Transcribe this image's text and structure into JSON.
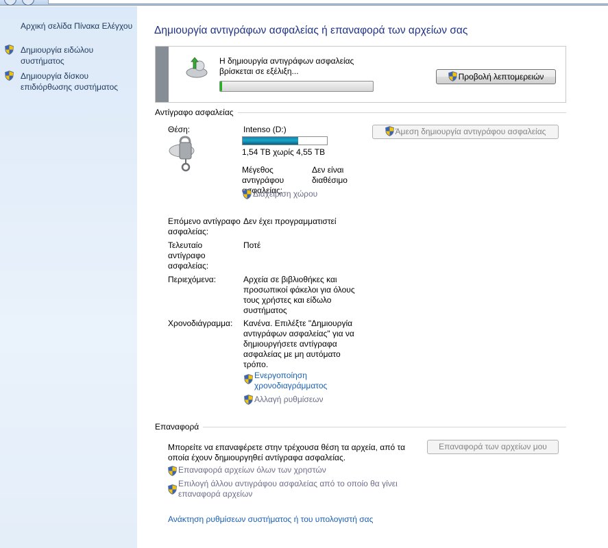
{
  "sidebar": {
    "home_link": "Αρχική σελίδα Πίνακα Ελέγχου",
    "links": [
      {
        "label": "Δημιουργία ειδώλου συστήματος"
      },
      {
        "label": "Δημιουργία δίσκου επιδιόρθωσης συστήματος"
      }
    ]
  },
  "main": {
    "title": "Δημιουργία αντιγράφων ασφαλείας ή επαναφορά των αρχείων σας",
    "status": {
      "message": "Η δημιουργία αντιγράφων ασφαλείας βρίσκεται σε εξέλιξη...",
      "progress_fraction": 0.01,
      "details_button": "Προβολή λεπτομερειών"
    },
    "backup": {
      "section_title": "Αντίγραφο ασφαλείας",
      "location_label": "Θέση:",
      "drive_name": "Intenso (D:)",
      "drive_used_fraction": 0.66,
      "drive_space": "1,54 TB χωρίς 4,55 TB",
      "size_label": "Μέγεθος αντιγράφου ασφαλείας:",
      "size_value": "Δεν είναι διαθέσιμο",
      "manage_space_link": "Διαχείριση χώρου",
      "backup_now_button": "Άμεση δημιουργία αντιγράφου ασφαλείας",
      "next_label": "Επόμενο αντίγραφο ασφαλείας:",
      "next_value": "Δεν έχει προγραμματιστεί",
      "last_label": "Τελευταίο αντίγραφο ασφαλείας:",
      "last_value": "Ποτέ",
      "contents_label": "Περιεχόμενα:",
      "contents_value": "Αρχεία σε βιβλιοθήκες και προσωπικοί φάκελοι για όλους τους χρήστες και είδωλο συστήματος",
      "schedule_label": "Χρονοδιάγραμμα:",
      "schedule_value": "Κανένα. Επιλέξτε \"Δημιουργία αντιγράφων ασφαλείας\" για να δημιουργήσετε αντίγραφα ασφαλείας με μη αυτόματο τρόπο.",
      "enable_schedule_link": "Ενεργοποίηση χρονοδιαγράμματος",
      "change_settings_link": "Αλλαγή ρυθμίσεων"
    },
    "restore": {
      "section_title": "Επαναφορά",
      "description": "Μπορείτε να επαναφέρετε στην τρέχουσα θέση τα αρχεία, από τα οποία έχουν δημιουργηθεί αντίγραφα ασφαλείας.",
      "restore_button": "Επαναφορά των αρχείων μου",
      "all_users_link": "Επαναφορά αρχείων όλων των χρηστών",
      "select_other_link": "Επιλογή άλλου αντιγράφου ασφαλείας από το οποίο θα γίνει επαναφορά αρχείων",
      "recover_link": "Ανάκτηση ρυθμίσεων συστήματος ή του υπολογιστή σας"
    }
  }
}
